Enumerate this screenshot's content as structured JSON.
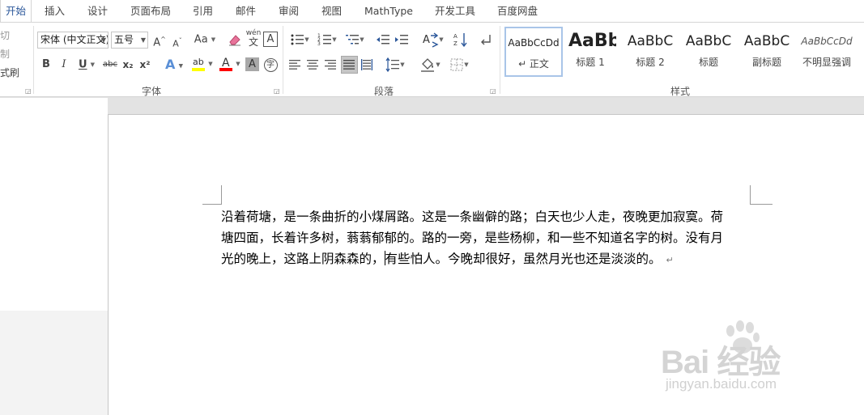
{
  "tabs": [
    {
      "label": "开始",
      "active": true
    },
    {
      "label": "插入"
    },
    {
      "label": "设计"
    },
    {
      "label": "页面布局"
    },
    {
      "label": "引用"
    },
    {
      "label": "邮件"
    },
    {
      "label": "审阅"
    },
    {
      "label": "视图"
    },
    {
      "label": "MathType"
    },
    {
      "label": "开发工具"
    },
    {
      "label": "百度网盘"
    }
  ],
  "clipboard": {
    "cut": "剪切",
    "copy": "复制",
    "format_painter": "格式刷"
  },
  "font": {
    "name": "宋体 (中文正文)",
    "size": "五号",
    "group_label": "字体",
    "phonetic_top": "wén",
    "phonetic_bottom": "文",
    "char_border": "A",
    "bold": "B",
    "italic": "I",
    "underline": "U",
    "strike": "abc",
    "subscript": "x₂",
    "superscript": "x²",
    "grow": "A",
    "shrink": "A",
    "case": "Aa",
    "shading": "A",
    "enclose": "字",
    "highlight_color": "#ffff00",
    "font_color": "#ff0000"
  },
  "paragraph": {
    "group_label": "段落"
  },
  "styles": {
    "group_label": "样式",
    "items": [
      {
        "sample": "AaBbCcDd",
        "name": "↵ 正文",
        "active": true
      },
      {
        "sample": "AaBb",
        "name": "标题 1"
      },
      {
        "sample": "AaBbC",
        "name": "标题 2"
      },
      {
        "sample": "AaBbC",
        "name": "标题"
      },
      {
        "sample": "AaBbC",
        "name": "副标题"
      },
      {
        "sample": "AaBbCcDd",
        "name": "不明显强调"
      }
    ]
  },
  "document": {
    "lines": [
      "沿着荷塘，是一条曲折的小煤屑路。这是一条幽僻的路；白天也少人走，夜晚更加寂寞。荷",
      "塘四面，长着许多树，蓊蓊郁郁的。路的一旁，是些杨柳，和一些不知道名字的树。没有月"
    ],
    "line3_before_cursor": "光的晚上，这路上阴森森的，",
    "line3_after_cursor": "有些怕人。今晚却很好，虽然月光也还是淡淡的。",
    "paragraph_mark": "↵"
  },
  "watermark": {
    "brand": "Bai 经验",
    "url": "jingyan.baidu.com"
  },
  "colors": {
    "accent": "#2b579a",
    "selected_button": "#c5c5c5"
  }
}
